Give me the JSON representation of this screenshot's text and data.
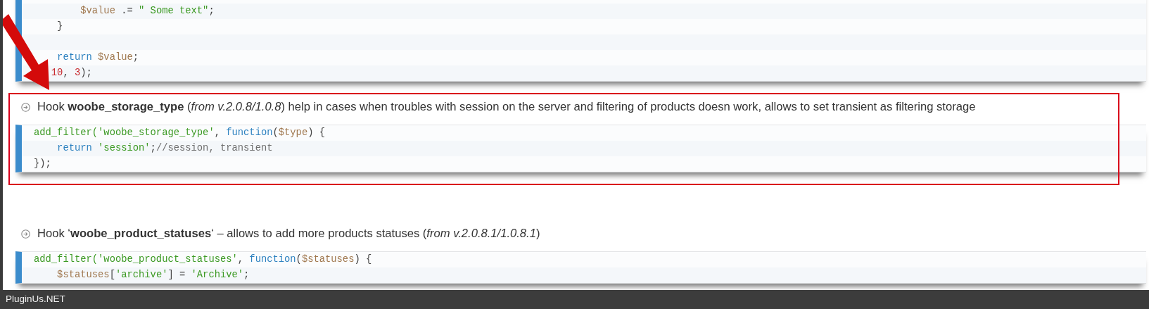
{
  "top_code": {
    "lines": [
      {
        "kind": "blank"
      },
      {
        "kind": "code",
        "tokens": [
          {
            "text": "        $value",
            "kind": "var"
          },
          {
            "text": " .= ",
            "kind": "plain"
          },
          {
            "text": "\" Some text\"",
            "kind": "str"
          },
          {
            "text": ";",
            "kind": "plain"
          }
        ]
      },
      {
        "kind": "code",
        "tokens": [
          {
            "text": "    }",
            "kind": "plain"
          }
        ]
      },
      {
        "kind": "blank"
      },
      {
        "kind": "code",
        "tokens": [
          {
            "text": "    return",
            "kind": "kw"
          },
          {
            "text": " $value",
            "kind": "var"
          },
          {
            "text": ";",
            "kind": "plain"
          }
        ]
      },
      {
        "kind": "code",
        "tokens": [
          {
            "text": "   10",
            "kind": "num"
          },
          {
            "text": ", ",
            "kind": "plain"
          },
          {
            "text": "3",
            "kind": "num"
          },
          {
            "text": ");",
            "kind": "plain"
          }
        ]
      }
    ]
  },
  "hooks": [
    {
      "heading": "Hook **woobe_storage_type** (*from v.2.0.8/1.0.8*) help in cases when troubles with session on the server and filtering of products doesn work, allows to set transient as filtering storage",
      "highlighted": true,
      "code": {
        "lines": [
          {
            "kind": "code",
            "tokens": [
              {
                "text": "add_filter('woobe_storage_type'",
                "kind": "str"
              },
              {
                "text": ", ",
                "kind": "plain"
              },
              {
                "text": "function",
                "kind": "kw"
              },
              {
                "text": "(",
                "kind": "plain"
              },
              {
                "text": "$type",
                "kind": "var"
              },
              {
                "text": ") {",
                "kind": "plain"
              }
            ]
          },
          {
            "kind": "code",
            "tokens": [
              {
                "text": "    return",
                "kind": "kw"
              },
              {
                "text": " 'session'",
                "kind": "str"
              },
              {
                "text": ";",
                "kind": "plain"
              },
              {
                "text": "//session, transient",
                "kind": "comment"
              }
            ]
          },
          {
            "kind": "code",
            "tokens": [
              {
                "text": "});",
                "kind": "plain"
              }
            ]
          }
        ]
      }
    },
    {
      "heading": "Hook ‘**woobe_product_statuses**‘ – allows to add more products statuses (*from v.2.0.8.1/1.0.8.1*)",
      "highlighted": false,
      "code": {
        "lines": [
          {
            "kind": "code",
            "tokens": [
              {
                "text": "add_filter('woobe_product_statuses'",
                "kind": "str"
              },
              {
                "text": ", ",
                "kind": "plain"
              },
              {
                "text": "function",
                "kind": "kw"
              },
              {
                "text": "(",
                "kind": "plain"
              },
              {
                "text": "$statuses",
                "kind": "var"
              },
              {
                "text": ") {",
                "kind": "plain"
              }
            ]
          },
          {
            "kind": "code",
            "tokens": [
              {
                "text": "    $statuses",
                "kind": "var"
              },
              {
                "text": "[",
                "kind": "plain"
              },
              {
                "text": "'archive'",
                "kind": "str"
              },
              {
                "text": "] = ",
                "kind": "plain"
              },
              {
                "text": "'Archive'",
                "kind": "str"
              },
              {
                "text": ";",
                "kind": "plain"
              }
            ]
          }
        ]
      }
    }
  ],
  "footer": {
    "brand": "PluginUs.NET"
  }
}
